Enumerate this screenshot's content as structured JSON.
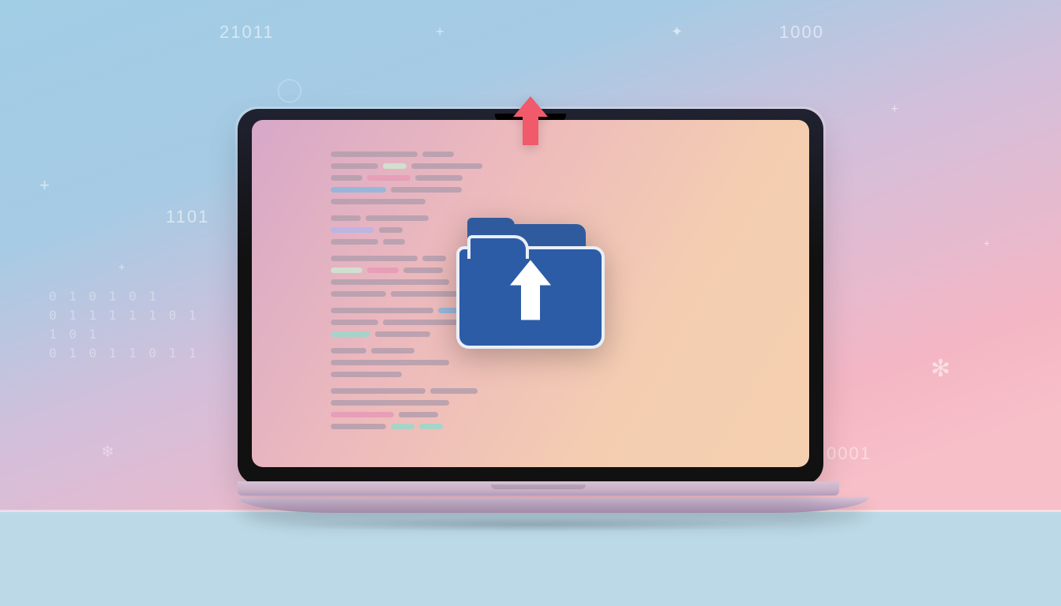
{
  "background_numbers": {
    "top_left": "21011",
    "top_right": "1000",
    "mid_left": "1101",
    "bottom_right": "0001",
    "binary_block": "0 1 0 1 0 1\n0 1 1 1 1 1 0 1\n1 0 1\n0 1 0 1 1 0 1 1"
  }
}
